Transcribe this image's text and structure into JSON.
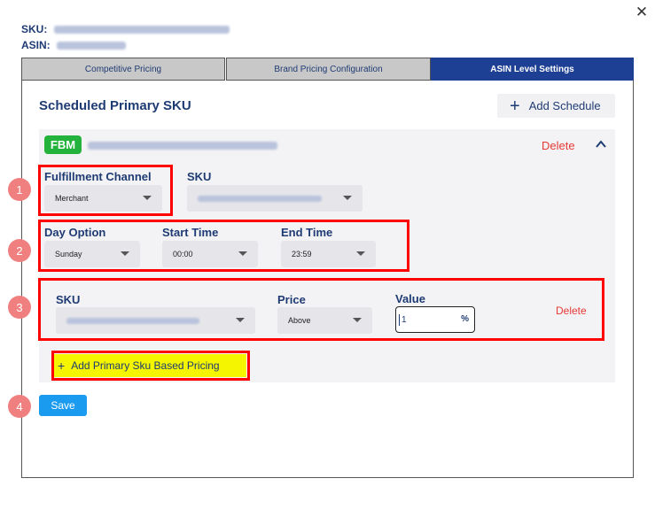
{
  "modal": {
    "close_icon": "close-icon"
  },
  "meta": {
    "sku_label": "SKU:",
    "asin_label": "ASIN:"
  },
  "tabs": [
    {
      "label": "Competitive Pricing",
      "active": false
    },
    {
      "label": "Brand Pricing Configuration",
      "active": false
    },
    {
      "label": "ASIN Level Settings",
      "active": true
    }
  ],
  "section": {
    "title": "Scheduled Primary SKU",
    "add_schedule_label": "Add Schedule",
    "add_schedule_icon": "plus-icon"
  },
  "card": {
    "badge": "FBM",
    "delete_label": "Delete",
    "collapse_icon": "chevron-up-icon"
  },
  "fields": {
    "fulfillment_channel": {
      "label": "Fulfillment Channel",
      "value": "Merchant"
    },
    "sku": {
      "label": "SKU"
    },
    "day_option": {
      "label": "Day Option",
      "value": "Sunday"
    },
    "start_time": {
      "label": "Start Time",
      "value": "00:00"
    },
    "end_time": {
      "label": "End Time",
      "value": "23:59"
    }
  },
  "pricing_row": {
    "sku_label": "SKU",
    "price_label": "Price",
    "price_value": "Above",
    "value_label": "Value",
    "value": "1",
    "value_suffix": "%",
    "delete_label": "Delete"
  },
  "add_primary_label": "Add Primary Sku Based Pricing",
  "add_primary_icon": "+",
  "save_label": "Save",
  "steps": [
    "1",
    "2",
    "3",
    "4"
  ],
  "colors": {
    "accent": "#1d3f94",
    "text": "#1f3b73",
    "delete": "#e53935",
    "badge": "#23b33d",
    "save": "#1a9bf0",
    "highlight": "#ff0000",
    "highlight_fill": "#f5f500",
    "step": "#f08080"
  }
}
